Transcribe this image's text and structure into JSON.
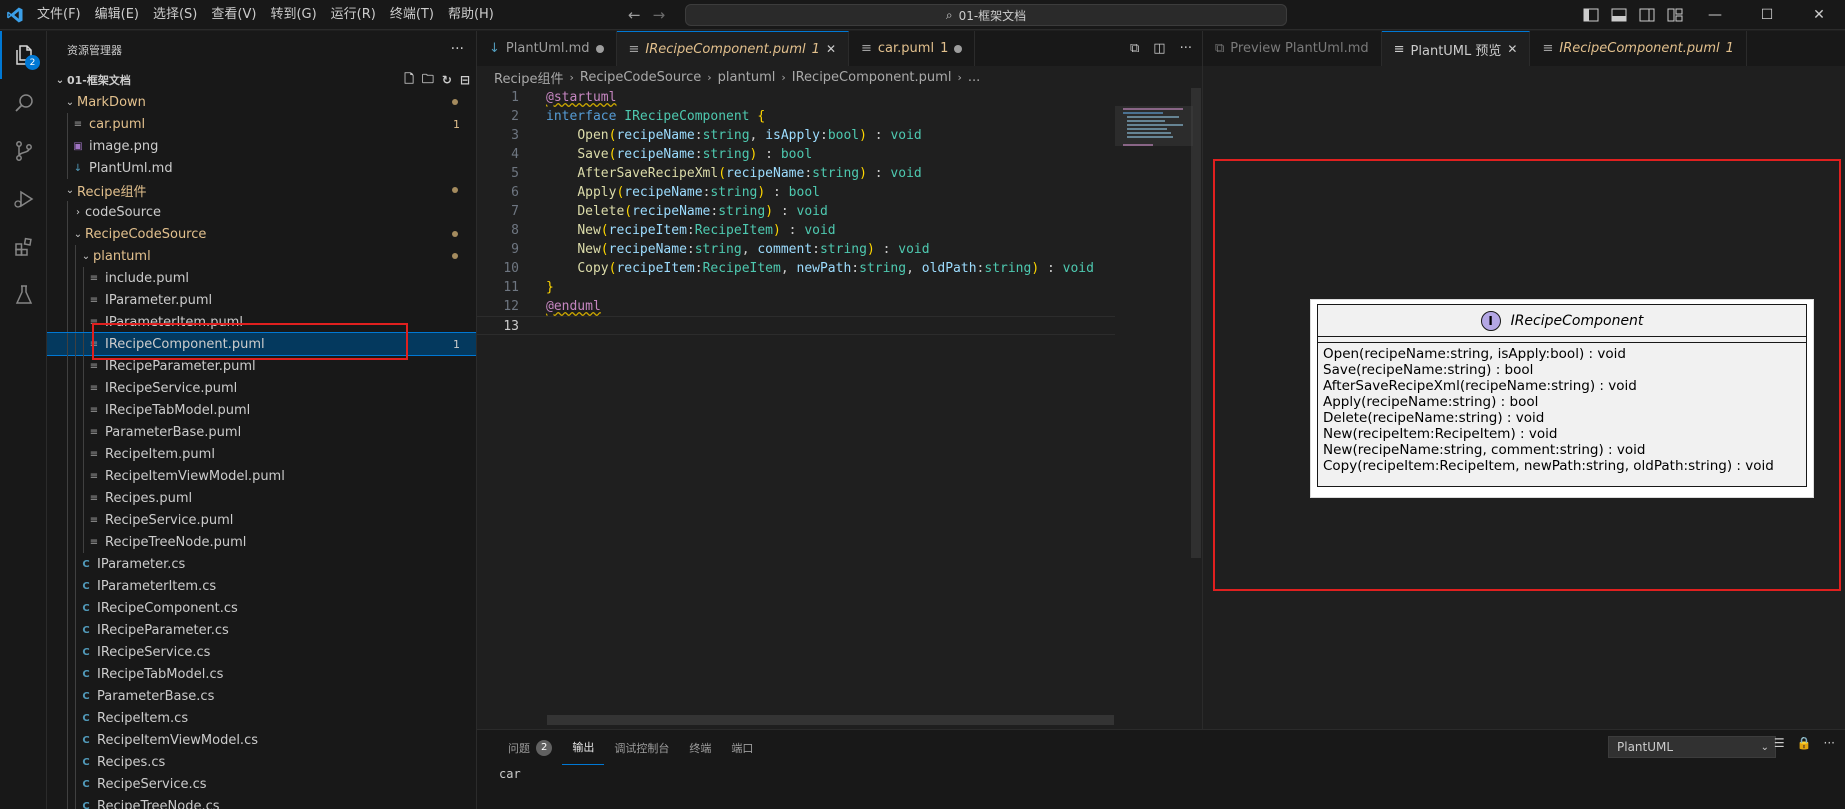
{
  "menu": [
    "文件(F)",
    "编辑(E)",
    "选择(S)",
    "查看(V)",
    "转到(G)",
    "运行(R)",
    "终端(T)",
    "帮助(H)"
  ],
  "command_center": "01-框架文档",
  "activity": {
    "explorer_badge": "2"
  },
  "sidebar": {
    "title": "资源管理器",
    "folder": "01-框架文档",
    "tree": [
      {
        "label": "MarkDown",
        "kind": "folder-open",
        "depth": 1,
        "mod": "dot"
      },
      {
        "label": "car.puml",
        "kind": "puml",
        "depth": 2,
        "mod": "1",
        "modcolor": "yellow",
        "modified": true
      },
      {
        "label": "image.png",
        "kind": "png",
        "depth": 2
      },
      {
        "label": "PlantUml.md",
        "kind": "md",
        "depth": 2
      },
      {
        "label": "Recipe组件",
        "kind": "folder-open",
        "depth": 1,
        "mod": "dot"
      },
      {
        "label": "codeSource",
        "kind": "folder-closed",
        "depth": 2
      },
      {
        "label": "RecipeCodeSource",
        "kind": "folder-open",
        "depth": 2,
        "mod": "dot"
      },
      {
        "label": "plantuml",
        "kind": "folder-open",
        "depth": 3,
        "mod": "dot"
      },
      {
        "label": "include.puml",
        "kind": "puml",
        "depth": 4
      },
      {
        "label": "IParameter.puml",
        "kind": "puml",
        "depth": 4
      },
      {
        "label": "IParameterItem.puml",
        "kind": "puml",
        "depth": 4
      },
      {
        "label": "IRecipeComponent.puml",
        "kind": "puml",
        "depth": 4,
        "mod": "1",
        "modcolor": "white",
        "selected": true
      },
      {
        "label": "IRecipeParameter.puml",
        "kind": "puml",
        "depth": 4
      },
      {
        "label": "IRecipeService.puml",
        "kind": "puml",
        "depth": 4
      },
      {
        "label": "IRecipeTabModel.puml",
        "kind": "puml",
        "depth": 4
      },
      {
        "label": "ParameterBase.puml",
        "kind": "puml",
        "depth": 4
      },
      {
        "label": "RecipeItem.puml",
        "kind": "puml",
        "depth": 4
      },
      {
        "label": "RecipeItemViewModel.puml",
        "kind": "puml",
        "depth": 4
      },
      {
        "label": "Recipes.puml",
        "kind": "puml",
        "depth": 4
      },
      {
        "label": "RecipeService.puml",
        "kind": "puml",
        "depth": 4
      },
      {
        "label": "RecipeTreeNode.puml",
        "kind": "puml",
        "depth": 4
      },
      {
        "label": "IParameter.cs",
        "kind": "cs",
        "depth": 3
      },
      {
        "label": "IParameterItem.cs",
        "kind": "cs",
        "depth": 3
      },
      {
        "label": "IRecipeComponent.cs",
        "kind": "cs",
        "depth": 3
      },
      {
        "label": "IRecipeParameter.cs",
        "kind": "cs",
        "depth": 3
      },
      {
        "label": "IRecipeService.cs",
        "kind": "cs",
        "depth": 3
      },
      {
        "label": "IRecipeTabModel.cs",
        "kind": "cs",
        "depth": 3
      },
      {
        "label": "ParameterBase.cs",
        "kind": "cs",
        "depth": 3
      },
      {
        "label": "RecipeItem.cs",
        "kind": "cs",
        "depth": 3
      },
      {
        "label": "RecipeItemViewModel.cs",
        "kind": "cs",
        "depth": 3
      },
      {
        "label": "Recipes.cs",
        "kind": "cs",
        "depth": 3
      },
      {
        "label": "RecipeService.cs",
        "kind": "cs",
        "depth": 3
      },
      {
        "label": "RecipeTreeNode.cs",
        "kind": "cs",
        "depth": 3
      }
    ]
  },
  "editor1": {
    "tabs": [
      {
        "label": "PlantUml.md",
        "icon": "md",
        "state": "dirty"
      },
      {
        "label": "IRecipeComponent.puml",
        "badge": "1",
        "state": "active"
      },
      {
        "label": "car.puml",
        "badge": "1",
        "state": "dirty"
      }
    ],
    "breadcrumb": [
      "Recipe组件",
      "RecipeCodeSource",
      "plantuml",
      "IRecipeComponent.puml",
      "..."
    ],
    "code": [
      "@startuml",
      "interface IRecipeComponent {",
      "    Open(recipeName:string, isApply:bool) : void",
      "    Save(recipeName:string) : bool",
      "    AfterSaveRecipeXml(recipeName:string) : void",
      "    Apply(recipeName:string) : bool",
      "    Delete(recipeName:string) : void",
      "    New(recipeItem:RecipeItem) : void",
      "    New(recipeName:string, comment:string) : void",
      "    Copy(recipeItem:RecipeItem, newPath:string, oldPath:string) : void",
      "}",
      "@enduml",
      ""
    ]
  },
  "editor2": {
    "tabs": [
      {
        "label": "Preview PlantUml.md",
        "state": "inactive"
      },
      {
        "label": "PlantUML 预览",
        "state": "active"
      },
      {
        "label": "IRecipeComponent.puml",
        "badge": "1",
        "state": "mod"
      }
    ],
    "uml": {
      "name": "IRecipeComponent",
      "stereotype_letter": "I",
      "methods": [
        "Open(recipeName:string, isApply:bool) : void",
        "Save(recipeName:string) : bool",
        "AfterSaveRecipeXml(recipeName:string) : void",
        "Apply(recipeName:string) : bool",
        "Delete(recipeName:string) : void",
        "New(recipeItem:RecipeItem) : void",
        "New(recipeName:string, comment:string) : void",
        "Copy(recipeItem:RecipeItem, newPath:string, oldPath:string) : void"
      ]
    }
  },
  "panel": {
    "tabs": [
      {
        "label": "问题",
        "badge": "2"
      },
      {
        "label": "输出",
        "active": true
      },
      {
        "label": "调试控制台"
      },
      {
        "label": "终端"
      },
      {
        "label": "端口"
      }
    ],
    "output_channel": "PlantUML",
    "output_lines": [
      "car",
      ""
    ]
  }
}
